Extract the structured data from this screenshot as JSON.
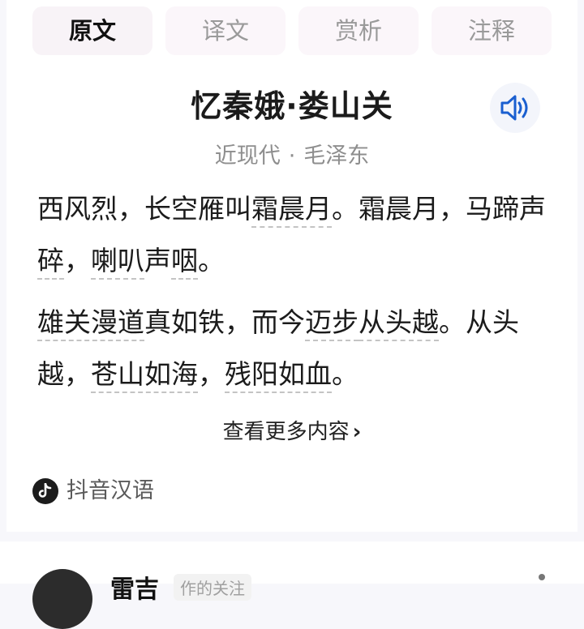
{
  "tabs": {
    "original": "原文",
    "translation": "译文",
    "appreciation": "赏析",
    "annotation": "注释"
  },
  "poem": {
    "title": "忆秦娥·娄山关",
    "dynasty": "近现代",
    "separator": "·",
    "author": "毛泽东",
    "lines": {
      "s1": "西风烈，长空雁叫",
      "s1n": "霜晨月",
      "s1b": "。",
      "s2": "霜晨月，马蹄",
      "s3": "声",
      "s3n": "碎",
      "s3b": "，",
      "s4n": "喇叭",
      "s4b": "声",
      "s5n": "咽",
      "s5b": "。",
      "s6n": "雄关漫道",
      "s6b": "真如铁，而今",
      "s7n": "迈步",
      "s8n": "从头越",
      "s8b": "。从头",
      "s9": "越，",
      "s9n": "苍山如海",
      "s9b": "，",
      "s10n": "残阳如血",
      "s10b": "。"
    }
  },
  "more_label": "查看更多内容",
  "more_chevron": "›",
  "source": {
    "label": "抖音汉语",
    "icon": "tiktok-icon"
  },
  "next_card": {
    "author_name": "雷吉",
    "badge": "作的关注"
  },
  "colors": {
    "accent": "#1a5fd0",
    "tab_bg": "#fbf6fa",
    "muted": "#8e8e8e"
  }
}
